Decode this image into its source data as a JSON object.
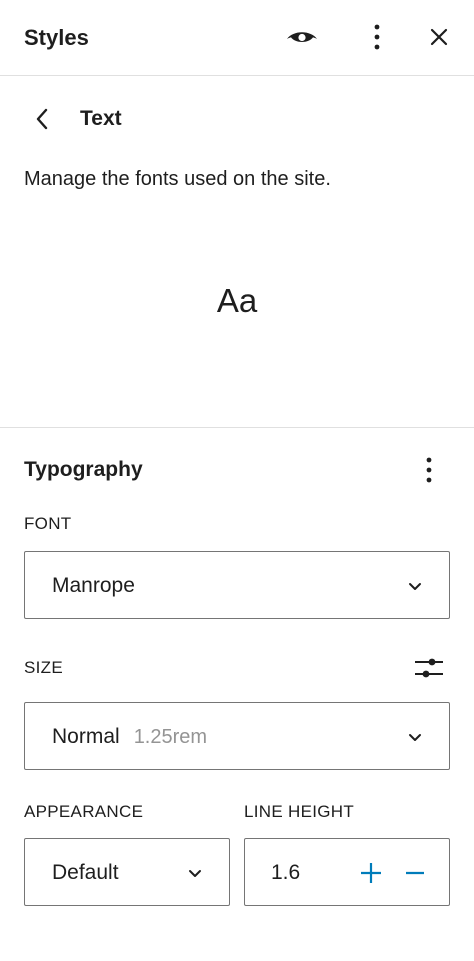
{
  "header": {
    "title": "Styles",
    "icons": [
      "eye-icon",
      "more-vertical-icon",
      "close-icon"
    ]
  },
  "nav": {
    "title": "Text",
    "back_icon": "chevron-left-icon"
  },
  "description": "Manage the fonts used on the site.",
  "preview": {
    "sample": "Aa"
  },
  "typography": {
    "title": "Typography",
    "font": {
      "label": "FONT",
      "value": "Manrope"
    },
    "size": {
      "label": "SIZE",
      "value": "Normal",
      "hint": "1.25rem"
    },
    "appearance": {
      "label": "APPEARANCE",
      "value": "Default"
    },
    "line_height": {
      "label": "LINE HEIGHT",
      "value": "1.6"
    }
  },
  "colors": {
    "text": "#1e1e1e",
    "muted": "#949494",
    "border": "#757575",
    "divider": "#e0e0e0",
    "accent": "#007cba"
  }
}
